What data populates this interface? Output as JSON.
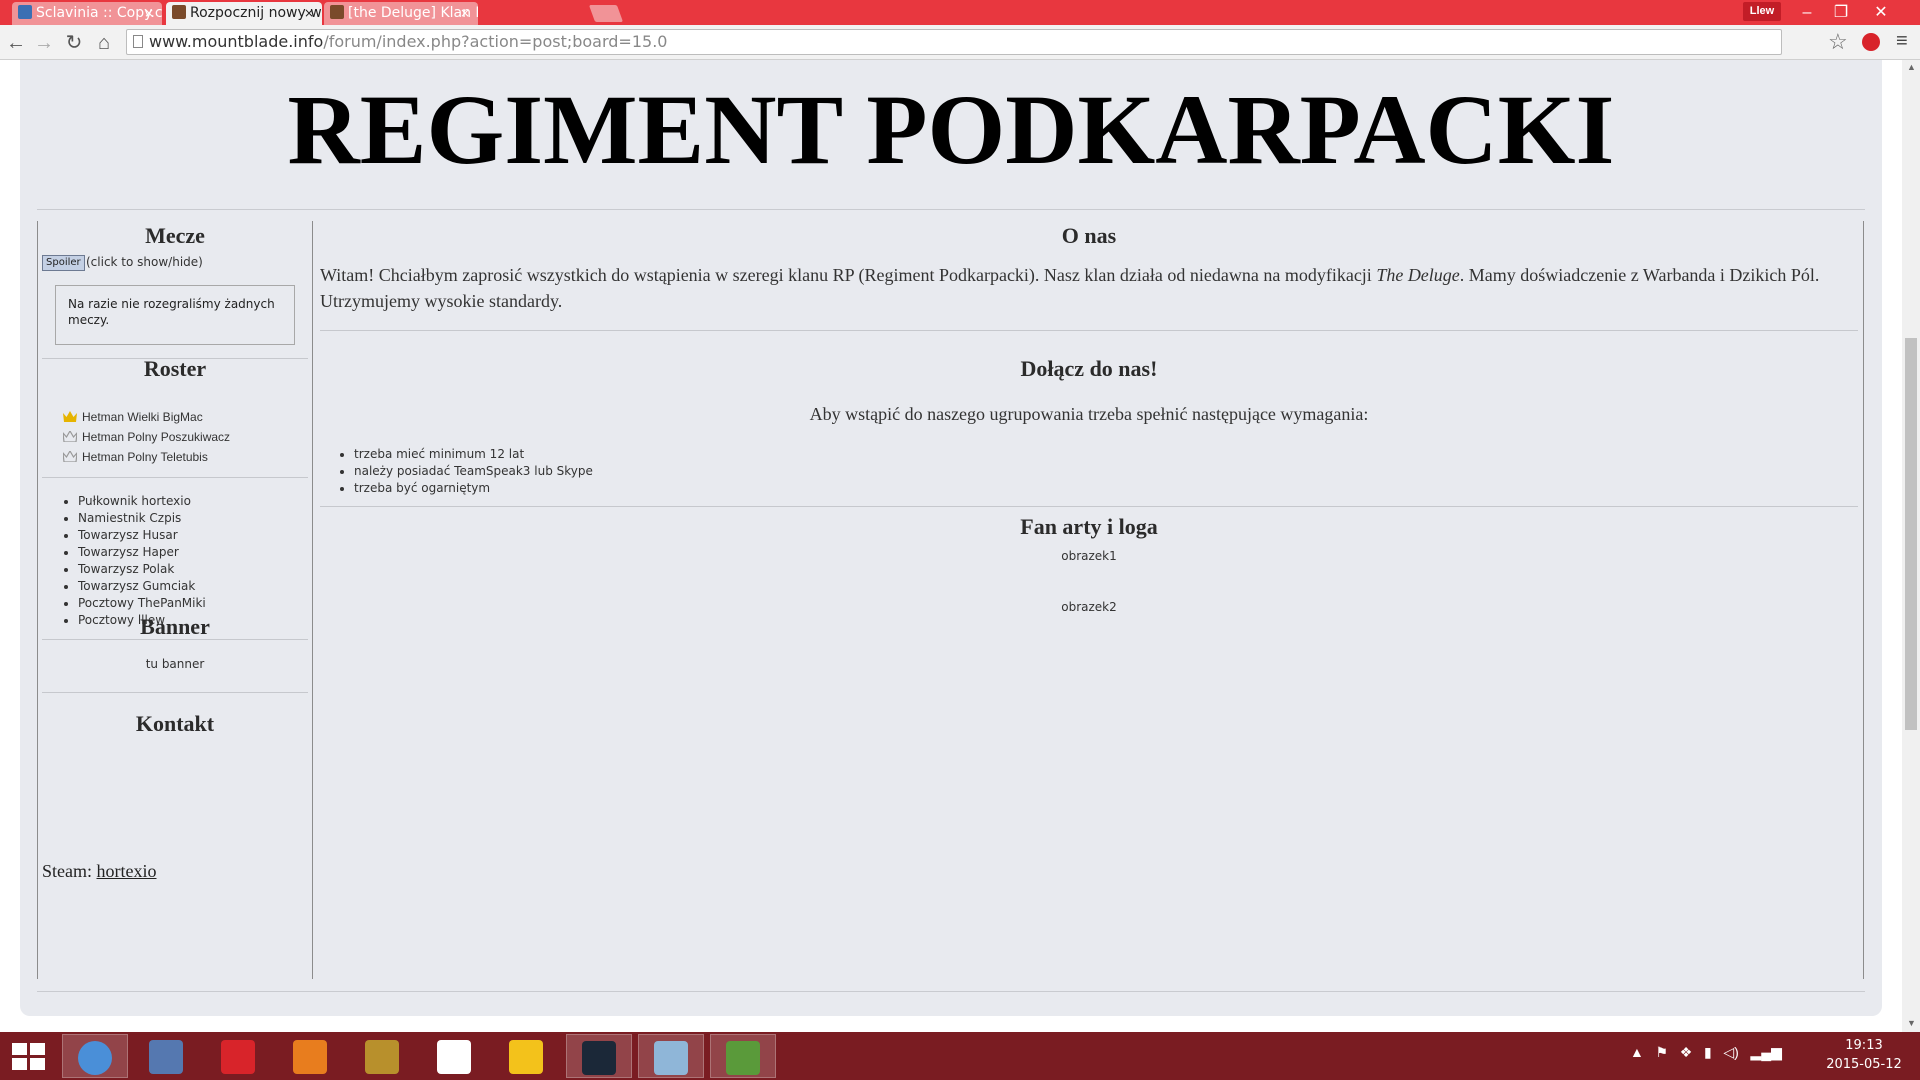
{
  "browser": {
    "tabs": [
      {
        "label": "Sclavinia :: Copy.com",
        "state": "inactive"
      },
      {
        "label": "Rozpocznij nowy wą",
        "state": "active"
      },
      {
        "label": "[the Deluge] Klan RP",
        "state": "inactive"
      }
    ],
    "close_glyph": "×",
    "profile_name": "Llew",
    "url_host": "www.mountblade.info",
    "url_path": "/forum/index.php?action=post;board=15.0",
    "icons": [
      "back-arrow-icon",
      "forward-arrow-icon",
      "reload-icon",
      "home-icon",
      "page-icon",
      "star-icon",
      "extension-icon",
      "menu-icon"
    ]
  },
  "site": {
    "title": "REGIMENT PODKARPACKI"
  },
  "sidebar": {
    "matches_heading": "Mecze",
    "spoiler_button": "Spoiler",
    "spoiler_hint": "(click to show/hide)",
    "matches_empty": "Na razie nie rozegraliśmy żadnych meczy.",
    "roster_heading": "Roster",
    "hetmans": [
      {
        "name": "Hetman Wielki BigMac",
        "crown": "gold"
      },
      {
        "name": "Hetman Polny Poszukiwacz",
        "crown": "gray"
      },
      {
        "name": "Hetman Polny Teletubis",
        "crown": "gray"
      }
    ],
    "members": [
      "Pułkownik hortexio",
      "Namiestnik Czpis",
      "Towarzysz Husar",
      "Towarzysz Haper",
      "Towarzysz Polak",
      "Towarzysz Gumciak",
      "Pocztowy ThePanMiki",
      "Pocztowy lllew"
    ],
    "banner_heading": "Banner",
    "banner_text": "tu banner",
    "contact_heading": "Kontakt",
    "steam_label": "Steam: ",
    "steam_link": "hortexio"
  },
  "content": {
    "about_heading": "O nas",
    "about_text_1": "Witam! Chciałbym zaprosić wszystkich do wstąpienia w szeregi klanu RP (Regiment Podkarpacki). Nasz klan działa od niedawna na modyfikacji ",
    "about_text_mod": "The Deluge",
    "about_text_2": ". Mamy doświadczenie z Warbanda i Dzikich Pól. Utrzymujemy wysokie standardy.",
    "join_heading": "Dołącz do nas!",
    "join_intro": "Aby wstąpić do naszego ugrupowania trzeba spełnić następujące wymagania:",
    "requirements": [
      "trzeba mieć minimum 12 lat",
      "należy posiadać TeamSpeak3 lub Skype",
      "trzeba być ogarniętym"
    ],
    "fanart_heading": "Fan arty i loga",
    "images": [
      "obrazek1",
      "obrazek2"
    ]
  },
  "taskbar": {
    "apps": [
      {
        "name": "chrome",
        "color": "#4a8fd8",
        "active": true
      },
      {
        "name": "file-manager",
        "color": "#5578b0",
        "active": false
      },
      {
        "name": "sketchup",
        "color": "#d8242a",
        "active": false
      },
      {
        "name": "blender",
        "color": "#e87d1e",
        "active": false
      },
      {
        "name": "dosbox",
        "color": "#b8902c",
        "active": false
      },
      {
        "name": "dropbox",
        "color": "#ffffff",
        "active": false
      },
      {
        "name": "sun-app",
        "color": "#f3c21b",
        "active": false
      },
      {
        "name": "steam",
        "color": "#1b2838",
        "active": true
      },
      {
        "name": "notepad",
        "color": "#8fb6d8",
        "active": true
      },
      {
        "name": "image-editor",
        "color": "#5a9a3a",
        "active": true
      }
    ],
    "time": "19:13",
    "date": "2015-05-12"
  }
}
